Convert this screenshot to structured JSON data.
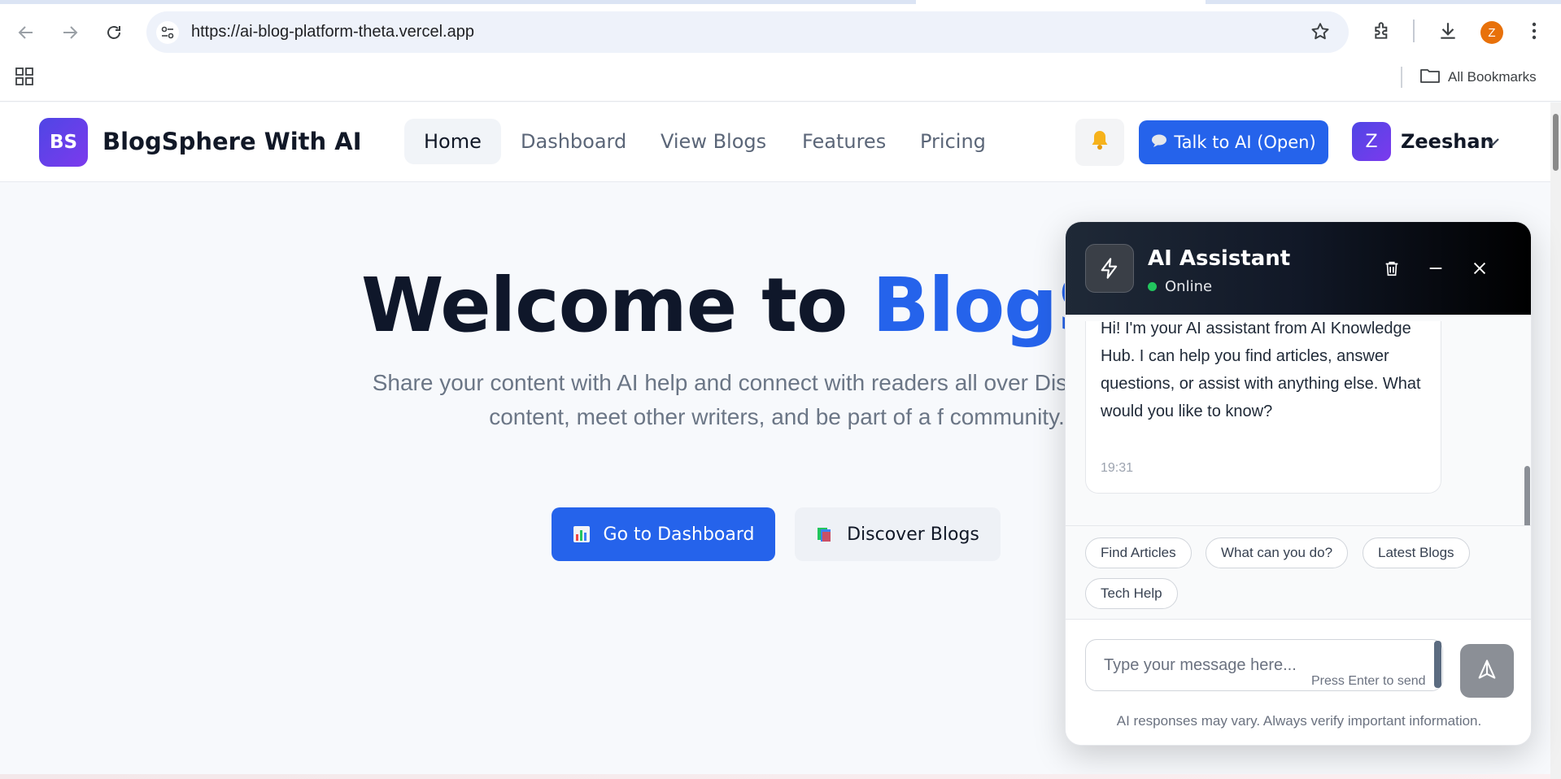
{
  "browser": {
    "url": "https://ai-blog-platform-theta.vercel.app",
    "profile_initial": "Z",
    "bookmarks_label": "All Bookmarks"
  },
  "site": {
    "logo_text": "BS",
    "brand": "BlogSphere With AI",
    "nav": [
      {
        "label": "Home",
        "active": true
      },
      {
        "label": "Dashboard",
        "active": false
      },
      {
        "label": "View Blogs",
        "active": false
      },
      {
        "label": "Features",
        "active": false
      },
      {
        "label": "Pricing",
        "active": false
      }
    ],
    "notification_icon": "bell-icon",
    "talk_ai_label": "Talk to AI (Open)",
    "user": {
      "initial": "Z",
      "name": "Zeeshan"
    }
  },
  "hero": {
    "title_plain": "Welcome to ",
    "title_accent": "BlogSph",
    "text": "Share your content with AI help and connect with readers all over Discover great content, meet other writers, and be part of a f community.",
    "cta_primary": "Go to Dashboard",
    "cta_secondary": "Discover Blogs"
  },
  "chat": {
    "title": "AI Assistant",
    "status": "Online",
    "message": "Hi! I'm your AI assistant from AI Knowledge Hub. I can help you find articles, answer questions, or assist with anything else. What would you like to know?",
    "message_time": "19:31",
    "suggestions": [
      "Find Articles",
      "What can you do?",
      "Latest Blogs",
      "Tech Help"
    ],
    "input_placeholder": "Type your message here...",
    "hint": "Press Enter to send",
    "disclaimer": "AI responses may vary. Always verify important information."
  },
  "colors": {
    "accent": "#2563eb",
    "brand_gradient_start": "#4f46e5",
    "brand_gradient_end": "#7c3aed",
    "online": "#22c55e"
  }
}
